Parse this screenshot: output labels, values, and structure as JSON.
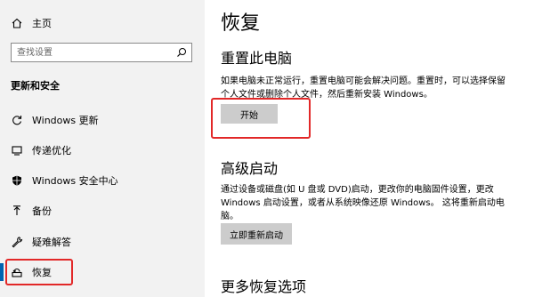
{
  "sidebar": {
    "home_label": "主页",
    "search_placeholder": "查找设置",
    "section_heading": "更新和安全",
    "items": [
      {
        "label": "Windows 更新",
        "icon": "refresh-icon"
      },
      {
        "label": "传递优化",
        "icon": "delivery-optimization-icon"
      },
      {
        "label": "Windows 安全中心",
        "icon": "shield-icon"
      },
      {
        "label": "备份",
        "icon": "backup-arrow-icon"
      },
      {
        "label": "疑难解答",
        "icon": "wrench-icon"
      },
      {
        "label": "恢复",
        "icon": "recovery-icon",
        "active": true
      }
    ]
  },
  "main": {
    "title": "恢复",
    "reset": {
      "heading": "重置此电脑",
      "desc_line1": "如果电脑未正常运行，重置电脑可能会解决问题。重置时，可以选择保留",
      "desc_line2": "个人文件或删除个人文件，然后重新安装 Windows。",
      "button": "开始"
    },
    "advanced": {
      "heading": "高级启动",
      "desc_line1": "通过设备或磁盘(如 U 盘或 DVD)启动，更改你的电脑固件设置，更改",
      "desc_line2": "Windows 启动设置，或者从系统映像还原 Windows。  这将重新启动电",
      "desc_line3": "脑。",
      "button": "立即重新启动"
    },
    "more": {
      "heading": "更多恢复选项"
    }
  },
  "colors": {
    "sidebar_bg": "#f2f2f2",
    "button_bg": "#cccccc",
    "highlight": "#e22828",
    "accent": "#0063b1"
  }
}
